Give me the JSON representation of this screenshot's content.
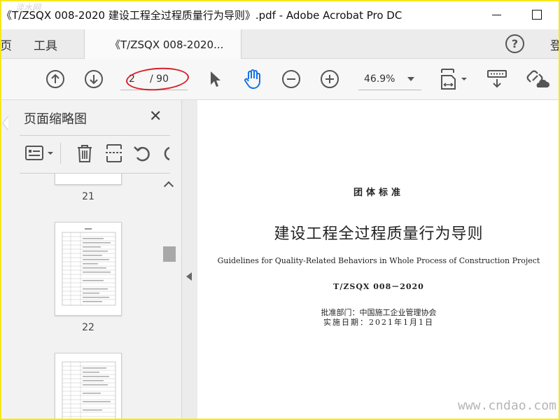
{
  "window": {
    "title": "《T/ZSQX 008-2020 建设工程全过程质量行为导则》.pdf - Adobe Acrobat Pro DC",
    "watermark_top": "淡水网"
  },
  "tabs": {
    "home_label": "页",
    "tools_label": "工具",
    "doc_label": "《T/ZSQX 008-2020...",
    "help_label": "?",
    "login_label": "登"
  },
  "toolbar": {
    "current_page": "2",
    "total_pages": "/ 90",
    "zoom": "46.9%"
  },
  "panel": {
    "title": "页面缩略图",
    "close_label": "✕",
    "thumbnails": [
      {
        "label": "21"
      },
      {
        "label": "22"
      },
      {
        "label": ""
      }
    ]
  },
  "document": {
    "category": "团体标准",
    "title_cn": "建设工程全过程质量行为导则",
    "title_en": "Guidelines for Quality-Related Behaviors in Whole Process of Construction Project",
    "code": "T/ZSQX 008－2020",
    "approved_by": "批准部门：中国施工企业管理协会",
    "effective_date": "实施日期：2021年1月1日"
  },
  "watermark": "www.cndao.com",
  "colors": {
    "annotation_red": "#d8202a",
    "border_yellow": "#f5e71c",
    "hand_tool_blue": "#1473e6"
  }
}
